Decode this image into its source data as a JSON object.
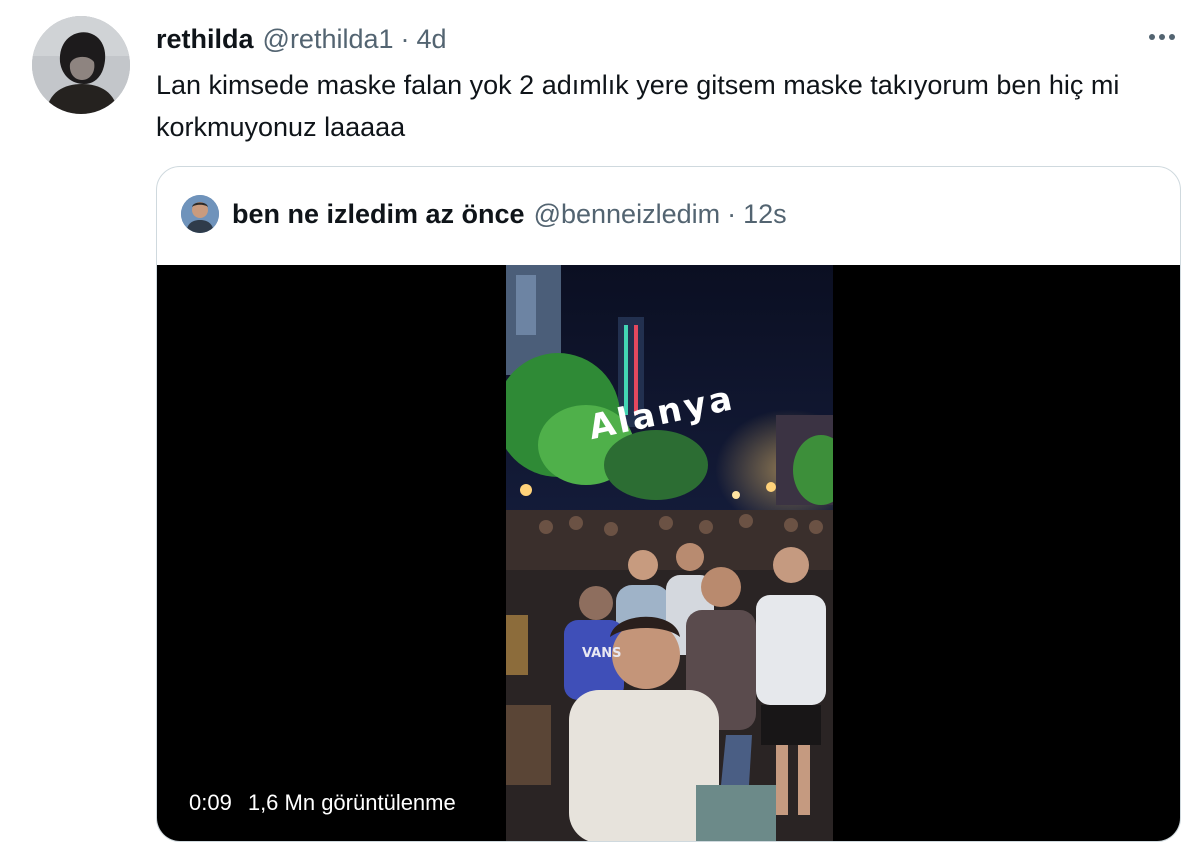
{
  "tweet": {
    "display_name": "rethilda",
    "handle": "@rethilda1",
    "separator": "·",
    "time": "4d",
    "text": "Lan kimsede maske falan yok 2 adımlık yere gitsem maske takıyorum ben hiç mi korkmuyonuz laaaaa",
    "more_icon": "more-horizontal-icon"
  },
  "quote": {
    "display_name": "ben ne izledim az önce",
    "handle": "@benneizledim",
    "separator": "·",
    "time": "12s",
    "video": {
      "overlay_text": "Alanya",
      "shirt_text": "VANS",
      "duration": "0:09",
      "views": "1,6 Mn görüntülenme"
    }
  },
  "colors": {
    "text_primary": "#0f1419",
    "text_secondary": "#536471",
    "border": "#cfd9de",
    "video_background": "#000000"
  }
}
